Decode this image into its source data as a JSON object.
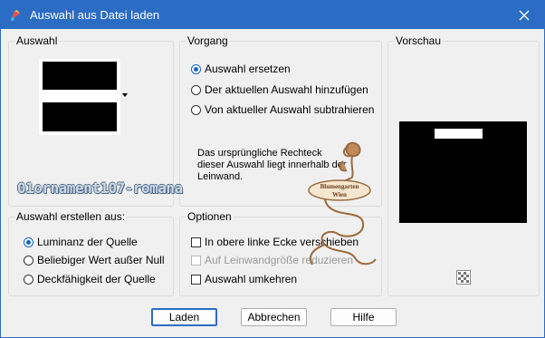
{
  "window": {
    "title": "Auswahl aus Datei laden",
    "accent": "#2b6cc4"
  },
  "auswahl": {
    "label": "Auswahl"
  },
  "vorgang": {
    "label": "Vorgang",
    "options": [
      {
        "label": "Auswahl ersetzen",
        "checked": true
      },
      {
        "label": "Der aktuellen Auswahl hinzufügen",
        "checked": false
      },
      {
        "label": "Von aktueller Auswahl subtrahieren",
        "checked": false
      }
    ],
    "info": "Das ursprüngliche Rechteck dieser Auswahl liegt innerhalb der Leinwand."
  },
  "vorschau": {
    "label": "Vorschau",
    "checker_icon": "transparency-checker-icon"
  },
  "erstellen": {
    "label": "Auswahl erstellen aus:",
    "options": [
      {
        "label": "Luminanz der Quelle",
        "checked": true
      },
      {
        "label": "Beliebiger Wert außer Null",
        "checked": false
      },
      {
        "label": "Deckfähigkeit der Quelle",
        "checked": false
      }
    ]
  },
  "optionen": {
    "label": "Optionen",
    "options": [
      {
        "label": "In obere linke Ecke verschieben",
        "checked": false,
        "disabled": false
      },
      {
        "label": "Auf Leinwandgröße reduzieren",
        "checked": false,
        "disabled": true
      },
      {
        "label": "Auswahl umkehren",
        "checked": false,
        "disabled": false
      }
    ]
  },
  "buttons": {
    "load": "Laden",
    "cancel": "Abbrechen",
    "help": "Hilfe"
  },
  "overlay": {
    "watermark": "01ornament107-romana",
    "stamp_line1": "Blumengarten",
    "stamp_line2": "Wien"
  }
}
